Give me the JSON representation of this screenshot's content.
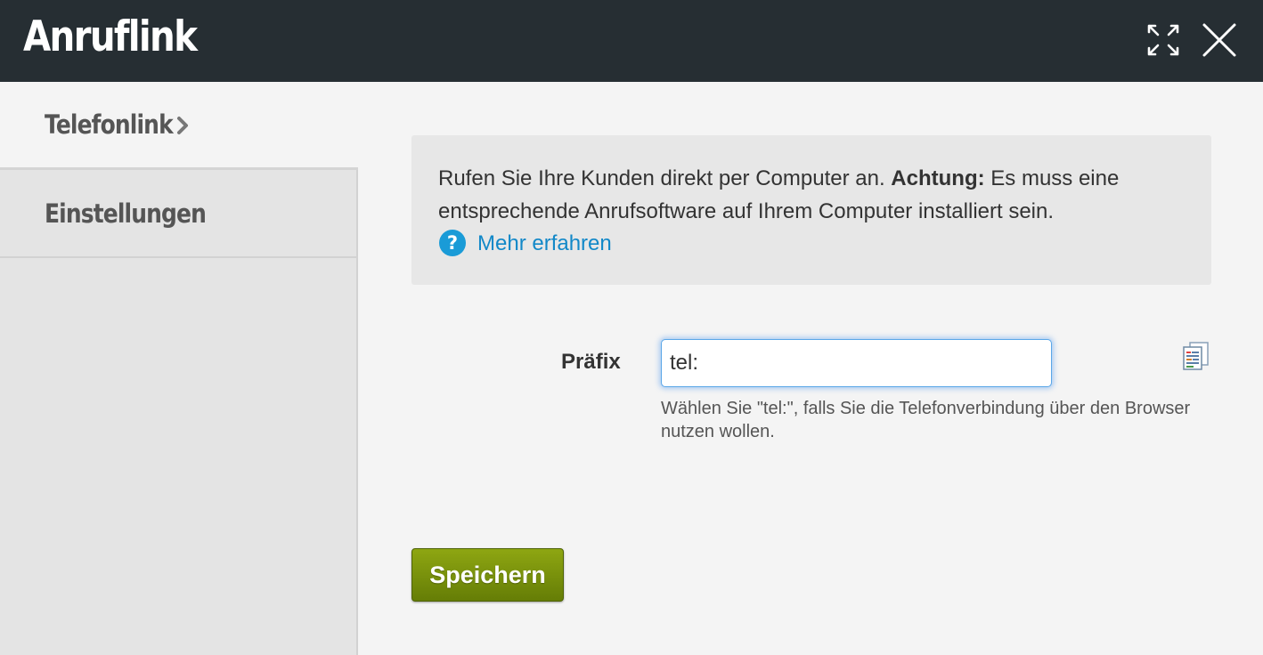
{
  "window": {
    "title": "Anruflink",
    "expand_icon": "expand-arrows-icon",
    "close_icon": "close-icon"
  },
  "sidebar": {
    "items": [
      {
        "label": "Telefonlink",
        "active": true,
        "icon": "chevron-right-icon"
      },
      {
        "label": "Einstellungen",
        "active": false
      }
    ]
  },
  "info": {
    "text_before": "Rufen Sie Ihre Kunden direkt per Computer an. ",
    "bold": "Achtung:",
    "text_after": " Es muss eine entsprechende Anrufsoftware auf Ihrem Computer installiert sein.",
    "learn_more": "Mehr erfahren",
    "help_icon": "question-circle-icon"
  },
  "form": {
    "prefix_label": "Präfix",
    "prefix_value": "tel:",
    "hint": "Wählen Sie \"tel:\", falls Sie die Telefonverbindung über den Browser nutzen wollen.",
    "clipboard_icon": "clipboard-icon"
  },
  "actions": {
    "save_label": "Speichern"
  },
  "colors": {
    "titlebar": "#262e33",
    "link": "#1288c8",
    "save_button": "#7a9110",
    "input_focus": "#5ba7e8"
  }
}
